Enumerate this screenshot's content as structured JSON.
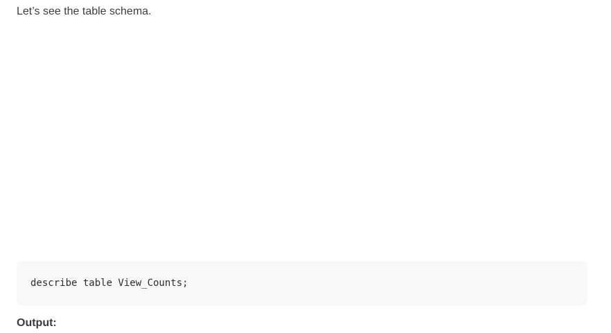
{
  "intro": {
    "text": "Let’s see the table schema."
  },
  "code_block": {
    "code": "describe table View_Counts;"
  },
  "output_label": {
    "text": "Output:"
  }
}
